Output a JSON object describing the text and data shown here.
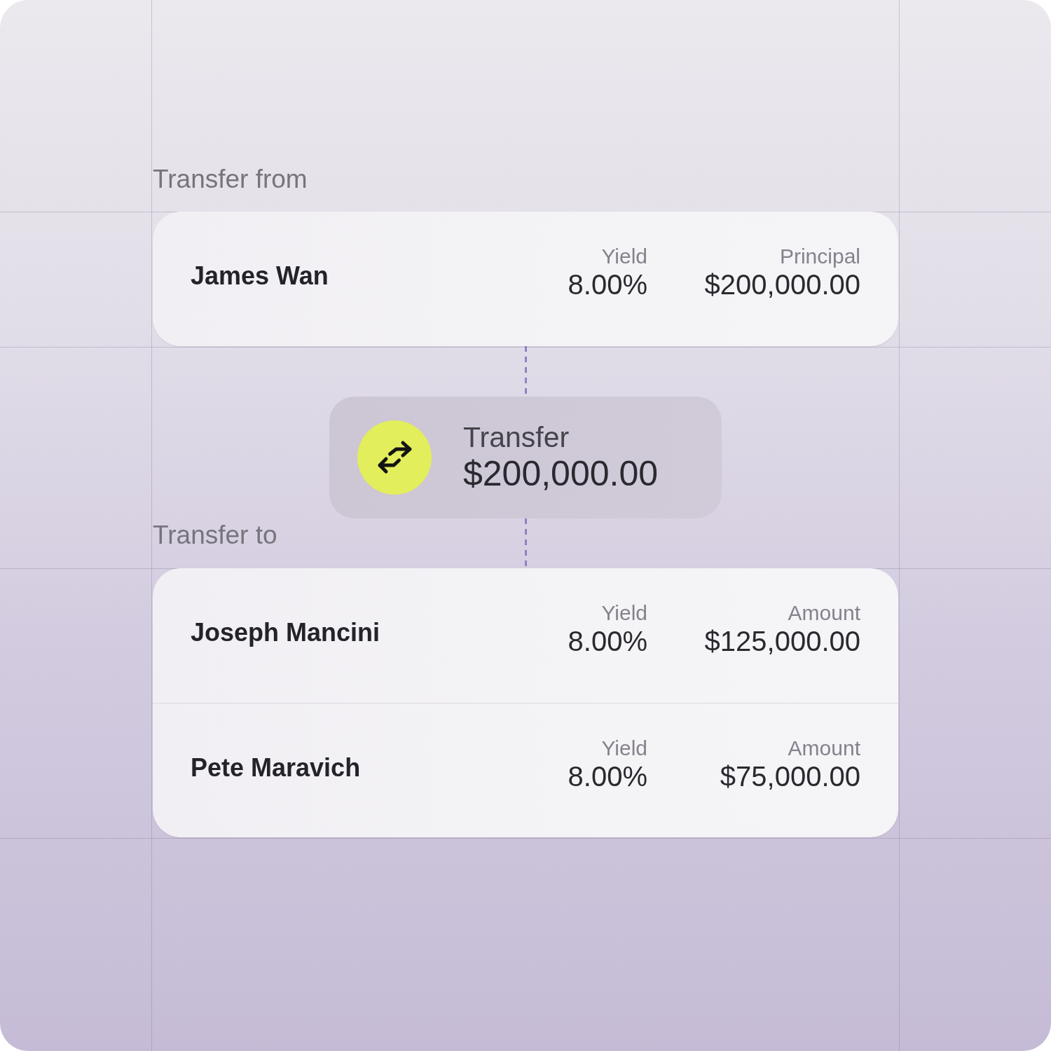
{
  "transfer_from": {
    "label": "Transfer from",
    "accounts": [
      {
        "name": "James Wan",
        "yield_label": "Yield",
        "yield": "8.00%",
        "amount_label": "Principal",
        "amount": "$200,000.00"
      }
    ]
  },
  "transfer": {
    "title": "Transfer",
    "amount": "$200,000.00"
  },
  "transfer_to": {
    "label": "Transfer to",
    "accounts": [
      {
        "name": "Joseph Mancini",
        "yield_label": "Yield",
        "yield": "8.00%",
        "amount_label": "Amount",
        "amount": "$125,000.00"
      },
      {
        "name": "Pete Maravich",
        "yield_label": "Yield",
        "yield": "8.00%",
        "amount_label": "Amount",
        "amount": "$75,000.00"
      }
    ]
  }
}
